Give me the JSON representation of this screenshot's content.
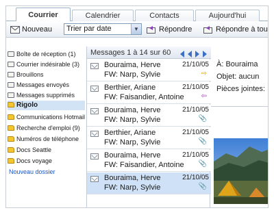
{
  "tabs": [
    {
      "label": "Courrier"
    },
    {
      "label": "Calendrier"
    },
    {
      "label": "Contacts"
    },
    {
      "label": "Aujourd'hui"
    }
  ],
  "toolbar": {
    "new_label": "Nouveau",
    "sort_value": "Trier par date",
    "reply_label": "Répondre",
    "reply_all_label": "Répondre à tous"
  },
  "folders": [
    {
      "label": "Boîte de réception (1)",
      "icon": "inbox-icon"
    },
    {
      "label": "Courrier indésirable (3)",
      "icon": "junk-icon"
    },
    {
      "label": "Brouillons",
      "icon": "drafts-icon"
    },
    {
      "label": "Messages envoyés",
      "icon": "sent-icon"
    },
    {
      "label": "Messages supprimés",
      "icon": "deleted-icon"
    },
    {
      "label": "Rigolo",
      "icon": "folder-icon"
    },
    {
      "label": "Communications Hotmail",
      "icon": "folder-icon"
    },
    {
      "label": "Recherche d'emploi (9)",
      "icon": "folder-icon"
    },
    {
      "label": "Numéros de téléphone",
      "icon": "folder-icon"
    },
    {
      "label": "Docs Seattle",
      "icon": "folder-icon"
    },
    {
      "label": "Docs voyage",
      "icon": "folder-icon"
    }
  ],
  "new_folder_label": "Nouveau dossier",
  "message_list": {
    "header": "Messages  1 à 14 sur 60",
    "messages": [
      {
        "sender": "Bouraima, Herve",
        "subject": "FW: Narp, Sylvie",
        "date": "21/10/05",
        "flag": "⇨"
      },
      {
        "sender": "Berthier, Ariane",
        "subject": "FW: Faisandier, Antoine",
        "date": "21/10/05",
        "flag": "⇦"
      },
      {
        "sender": "Bouraima, Herve",
        "subject": "FW: Narp, Sylvie",
        "date": "21/10/05",
        "flag": "📎"
      },
      {
        "sender": "Berthier, Ariane",
        "subject": "FW: Narp, Sylvie",
        "date": "21/10/05",
        "flag": "📎"
      },
      {
        "sender": "Bouraima, Herve",
        "subject": "FW: Faisandier, Antoine",
        "date": "21/10/05",
        "flag": "📎"
      },
      {
        "sender": "Bouraima, Herve",
        "subject": "FW: Narp, Sylvie",
        "date": "21/10/05",
        "flag": "📎"
      }
    ]
  },
  "reading_pane": {
    "to_line": "À:  Bouraima",
    "subject_line": "Objet:  aucun",
    "attachments_line": "Pièces jointes:"
  },
  "colors": {
    "selection": "#cfe1f6",
    "link": "#1a55c4",
    "accent": "#3c6fc4"
  }
}
